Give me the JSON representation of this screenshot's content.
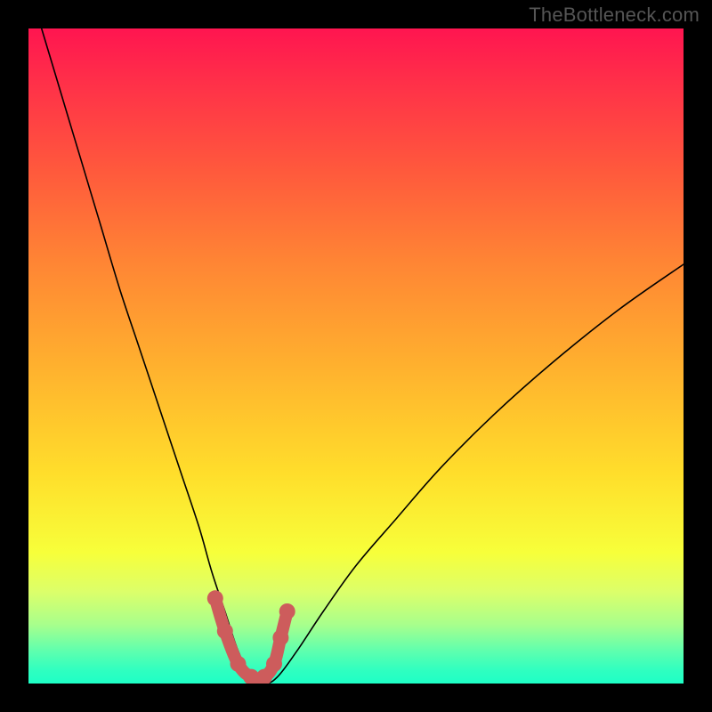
{
  "watermark": "TheBottleneck.com",
  "colors": {
    "frame": "#000000",
    "curve": "#000000",
    "markers": "#cd5c5c",
    "watermark_text": "#555555"
  },
  "chart_data": {
    "type": "line",
    "title": "",
    "xlabel": "",
    "ylabel": "",
    "xlim": [
      0,
      100
    ],
    "ylim": [
      0,
      100
    ],
    "grid": false,
    "legend": false,
    "note": "Bottleneck-style V-curve: y is mismatch % vs a normalized x parameter; minimum (~0%) near x≈33; values estimated from the rendered curve.",
    "series": [
      {
        "name": "curve",
        "x": [
          2,
          5,
          8,
          11,
          14,
          17,
          20,
          23,
          26,
          28,
          30,
          32,
          34,
          36,
          38,
          41,
          45,
          50,
          56,
          63,
          71,
          80,
          90,
          100
        ],
        "y": [
          100,
          90,
          80,
          70,
          60,
          51,
          42,
          33,
          24,
          17,
          11,
          5,
          1,
          0,
          1,
          5,
          11,
          18,
          25,
          33,
          41,
          49,
          57,
          64
        ]
      }
    ],
    "markers": {
      "name": "highlighted-range",
      "x": [
        28.5,
        30,
        32,
        34,
        36,
        37.5,
        38.5,
        39.5
      ],
      "y": [
        13,
        8,
        3,
        1,
        1,
        3,
        7,
        11
      ]
    }
  }
}
